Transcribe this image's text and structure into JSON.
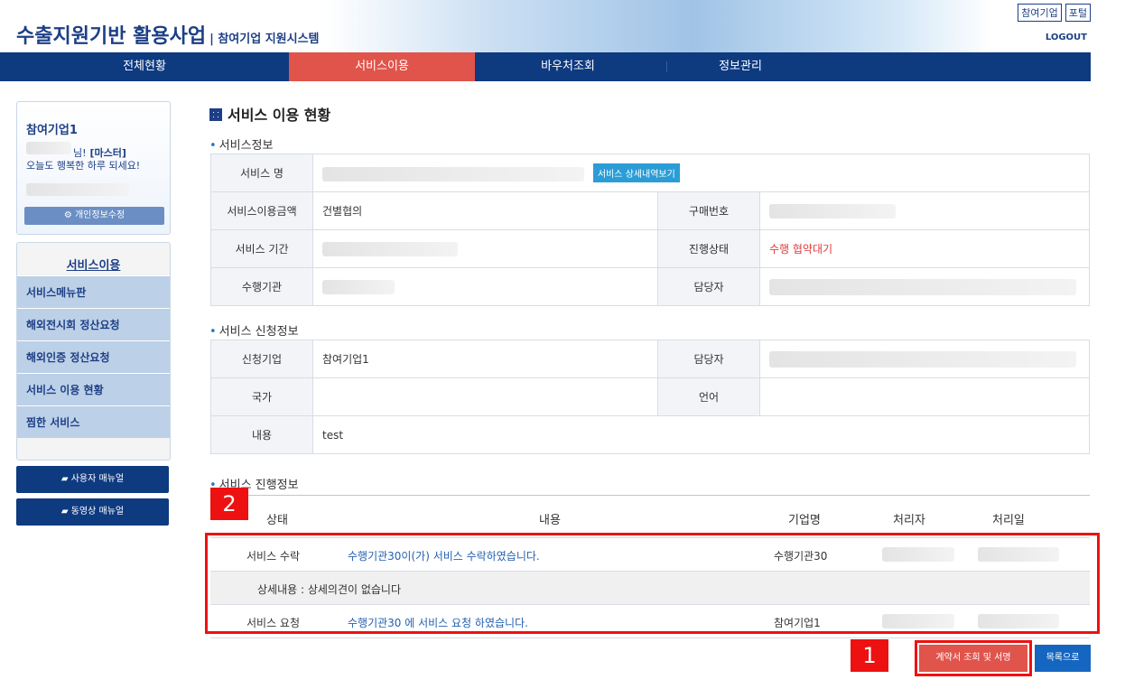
{
  "header": {
    "title": "수출지원기반 활용사업",
    "subtitle": "| 참여기업 지원시스템",
    "top_links": [
      "참여기업",
      "포털"
    ],
    "logout": "LOGOUT"
  },
  "nav": {
    "items": [
      "전체현황",
      "서비스이용",
      "바우처조회",
      "정보관리"
    ],
    "active": "서비스이용"
  },
  "profile": {
    "company": "참여기업1",
    "greeting_suffix": "님!",
    "role": "[마스터]",
    "greeting_line": "오늘도 행복한 하루 되세요!",
    "edit_button": "개인정보수정"
  },
  "side_menu": {
    "title": "서비스이용",
    "items": [
      "서비스메뉴판",
      "해외전시회 정산요청",
      "해외인증 정산요청",
      "서비스 이용 현황",
      "찜한 서비스"
    ],
    "manual_buttons": [
      "사용자 매뉴얼",
      "동영상 매뉴얼"
    ]
  },
  "main": {
    "title": "서비스 이용 현황",
    "service_info": {
      "title": "서비스정보",
      "name_label": "서비스 명",
      "detail_button": "서비스 상세내역보기",
      "amount_label": "서비스이용금액",
      "amount_value": "건별협의",
      "purchase_no_label": "구매번호",
      "period_label": "서비스 기간",
      "status_label": "진행상태",
      "status_value": "수행 협약대기",
      "agency_label": "수행기관",
      "manager_label": "담당자"
    },
    "request_info": {
      "title": "서비스 신청정보",
      "company_label": "신청기업",
      "company_value": "참여기업1",
      "manager_label": "담당자",
      "country_label": "국가",
      "language_label": "언어",
      "content_label": "내용",
      "content_value": "test"
    },
    "progress_info": {
      "title": "서비스 진행정보",
      "headers": [
        "상태",
        "내용",
        "기업명",
        "처리자",
        "처리일"
      ],
      "rows": [
        {
          "status": "서비스 수락",
          "content": "수행기관30이(가) 서비스 수락하였습니다.",
          "company": "수행기관30"
        },
        {
          "detail": "상세내용 : 상세의견이 없습니다"
        },
        {
          "status": "서비스 요청",
          "content": "수행기관30 에 서비스 요청 하였습니다.",
          "company": "참여기업1"
        }
      ]
    },
    "buttons": {
      "contract": "계약서 조회 및 서명",
      "list": "목록으로"
    }
  },
  "annotations": {
    "badge1": "1",
    "badge2": "2"
  },
  "colors": {
    "nav_bg": "#0e3a80",
    "nav_active": "#e0544b",
    "annotation_red": "#ee1111",
    "status_red": "#e03a3a",
    "link_blue": "#2460b0"
  }
}
